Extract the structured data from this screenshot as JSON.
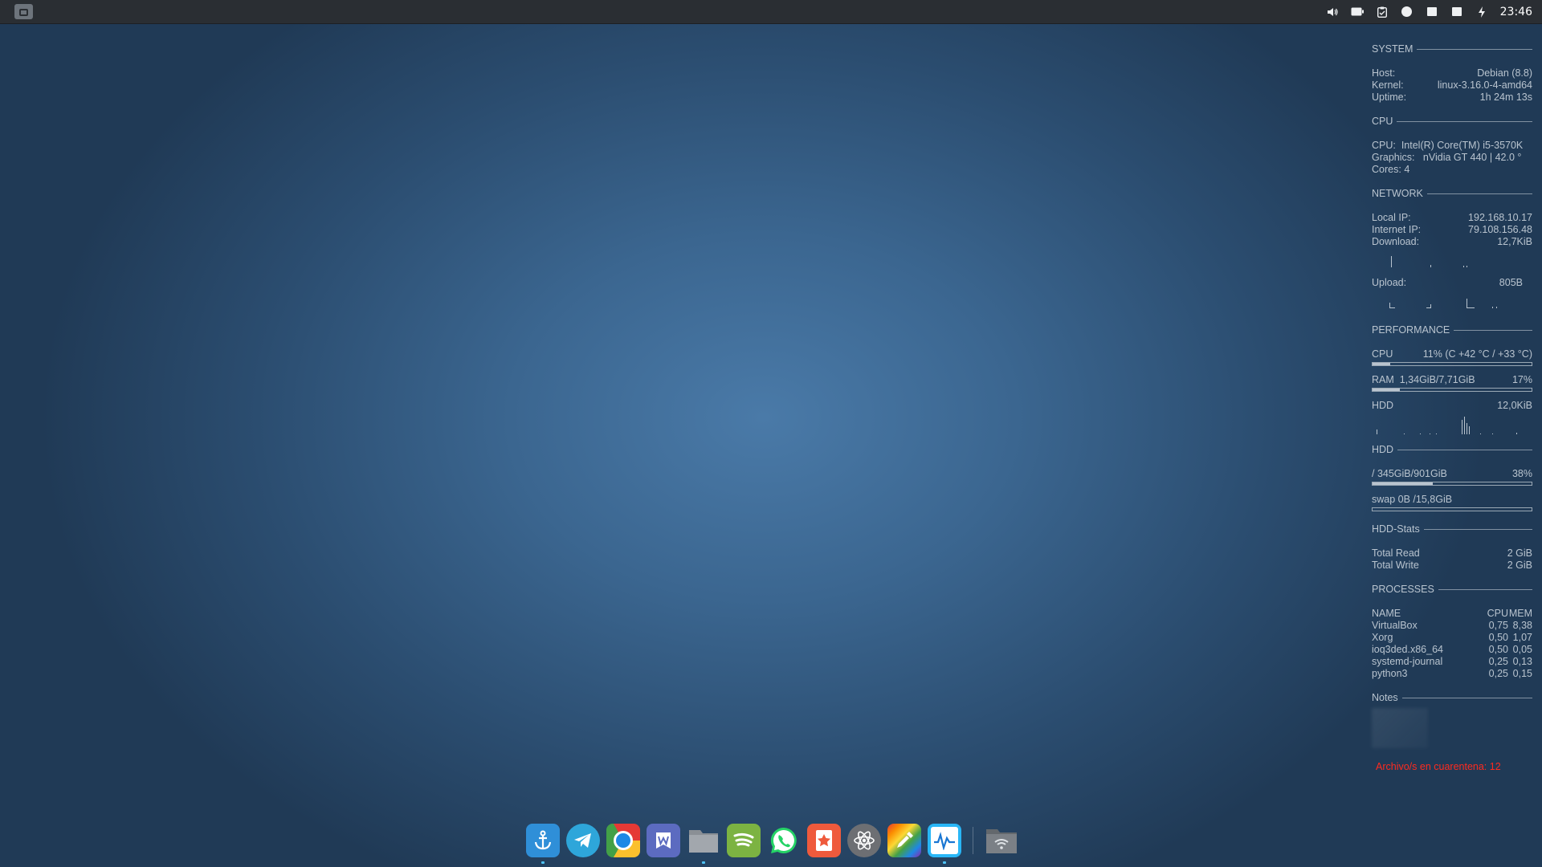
{
  "topbar": {
    "clock": "23:46",
    "tray_icons": [
      "volume-icon",
      "battery-icon",
      "clipboard-icon",
      "circle-icon",
      "square-icon",
      "square-icon",
      "sync-icon"
    ]
  },
  "conky": {
    "system": {
      "title": "SYSTEM",
      "rows": [
        {
          "label": "Host:",
          "value": "Debian (8.8)"
        },
        {
          "label": "Kernel:",
          "value": "linux-3.16.0-4-amd64"
        },
        {
          "label": "Uptime:",
          "value": "1h 24m 13s"
        }
      ]
    },
    "cpu": {
      "title": "CPU",
      "rows": [
        {
          "label": "CPU:",
          "value": "Intel(R) Core(TM) i5-3570K"
        },
        {
          "label": "Graphics:",
          "value": "nVidia GT 440 | 42.0 °"
        },
        {
          "label": "Cores:",
          "value": "4"
        }
      ]
    },
    "network": {
      "title": "NETWORK",
      "local_ip_label": "Local IP:",
      "local_ip": "192.168.10.17",
      "internet_ip_label": "Internet IP:",
      "internet_ip": "79.108.156.48",
      "download_label": "Download:",
      "download": "12,7KiB",
      "upload_label": "Upload:",
      "upload": "805B"
    },
    "performance": {
      "title": "PERFORMANCE",
      "cpu_label": "CPU",
      "cpu_value": "11% (C  +42 °C /  +33 °C)",
      "cpu_fraction": 0.11,
      "ram_label": "RAM",
      "ram_value": "1,34GiB/7,71GiB",
      "ram_percent": "17%",
      "ram_fraction": 0.17,
      "hdd_label": "HDD",
      "hdd_value": "12,0KiB"
    },
    "hdd": {
      "title": "HDD",
      "root_label": "/  345GiB/901GiB",
      "root_percent": "38%",
      "root_fraction": 0.38,
      "swap_label": "swap 0B  /15,8GiB",
      "swap_fraction": 0.0
    },
    "hdd_stats": {
      "title": "HDD-Stats",
      "rows": [
        {
          "label": "Total Read",
          "value": "2 GiB"
        },
        {
          "label": "Total Write",
          "value": "2 GiB"
        }
      ]
    },
    "processes": {
      "title": "PROCESSES",
      "header": {
        "name": "NAME",
        "cpu": "CPU",
        "mem": "MEM"
      },
      "rows": [
        {
          "name": "VirtualBox",
          "cpu": "0,75",
          "mem": "8,38"
        },
        {
          "name": "Xorg",
          "cpu": "0,50",
          "mem": "1,07"
        },
        {
          "name": "ioq3ded.x86_64",
          "cpu": "0,50",
          "mem": "0,05"
        },
        {
          "name": "systemd-journal",
          "cpu": "0,25",
          "mem": "0,13"
        },
        {
          "name": "python3",
          "cpu": "0,25",
          "mem": "0,15"
        }
      ]
    },
    "notes": {
      "title": "Notes"
    },
    "quarantine": "Archivo/s en cuarentena: 12"
  },
  "dock": {
    "apps": [
      {
        "name": "anchor-app-icon",
        "color": "#2f8fd8",
        "running": true
      },
      {
        "name": "telegram-icon",
        "color": "#2ea6da",
        "running": false
      },
      {
        "name": "chrome-icon",
        "color": "#e53935",
        "running": false
      },
      {
        "name": "wps-writer-icon",
        "color": "#5c6bc0",
        "running": false
      },
      {
        "name": "files-icon",
        "color": "#7a7f85",
        "running": true
      },
      {
        "name": "spotify-icon",
        "color": "#7cb342",
        "running": false
      },
      {
        "name": "whatsapp-icon",
        "color": "#25d366",
        "running": false
      },
      {
        "name": "bookmark-star-icon",
        "color": "#ef5a3c",
        "running": false
      },
      {
        "name": "atom-icon",
        "color": "#6d6f73",
        "running": false
      },
      {
        "name": "color-picker-icon",
        "color": "#8e44ad",
        "running": false
      },
      {
        "name": "system-monitor-icon",
        "color": "#29b6f6",
        "running": true
      }
    ],
    "trailing": {
      "name": "network-folder-icon",
      "color": "#6f7479"
    }
  }
}
